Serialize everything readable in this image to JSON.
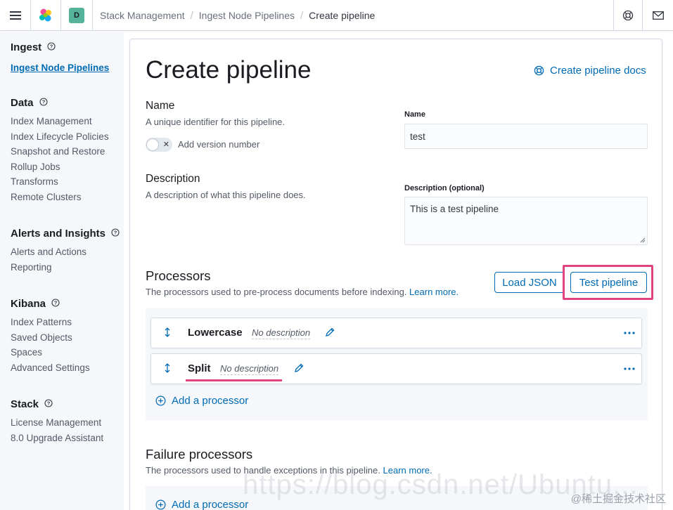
{
  "header": {
    "space_initial": "D",
    "breadcrumbs": [
      "Stack Management",
      "Ingest Node Pipelines",
      "Create pipeline"
    ]
  },
  "sidebar": {
    "groups": [
      {
        "title": "Ingest",
        "items": [
          "Ingest Node Pipelines"
        ]
      },
      {
        "title": "Data",
        "items": [
          "Index Management",
          "Index Lifecycle Policies",
          "Snapshot and Restore",
          "Rollup Jobs",
          "Transforms",
          "Remote Clusters"
        ]
      },
      {
        "title": "Alerts and Insights",
        "items": [
          "Alerts and Actions",
          "Reporting"
        ]
      },
      {
        "title": "Kibana",
        "items": [
          "Index Patterns",
          "Saved Objects",
          "Spaces",
          "Advanced Settings"
        ]
      },
      {
        "title": "Stack",
        "items": [
          "License Management",
          "8.0 Upgrade Assistant"
        ]
      }
    ]
  },
  "page": {
    "title": "Create pipeline",
    "docs_link": "Create pipeline docs",
    "name_section": {
      "title": "Name",
      "description": "A unique identifier for this pipeline.",
      "toggle_label": "Add version number",
      "field_label": "Name",
      "field_value": "test"
    },
    "description_section": {
      "title": "Description",
      "description": "A description of what this pipeline does.",
      "field_label": "Description (optional)",
      "field_value": "This is a test pipeline"
    },
    "processors": {
      "title": "Processors",
      "description": "The processors used to pre-process documents before indexing.",
      "learn_more": "Learn more.",
      "load_json": "Load JSON",
      "test_pipeline": "Test pipeline",
      "items": [
        {
          "name": "Lowercase",
          "description": "No description"
        },
        {
          "name": "Split",
          "description": "No description"
        }
      ],
      "add_label": "Add a processor"
    },
    "failure_processors": {
      "title": "Failure processors",
      "description": "The processors used to handle exceptions in this pipeline.",
      "learn_more": "Learn more.",
      "add_label": "Add a processor"
    }
  },
  "watermarks": {
    "url": "https://blog.csdn.net/Ubuntu...",
    "site": "@稀土掘金技术社区"
  },
  "colors": {
    "accent": "#006bb4",
    "highlight": "#e0447e",
    "space_badge": "#54b399"
  }
}
